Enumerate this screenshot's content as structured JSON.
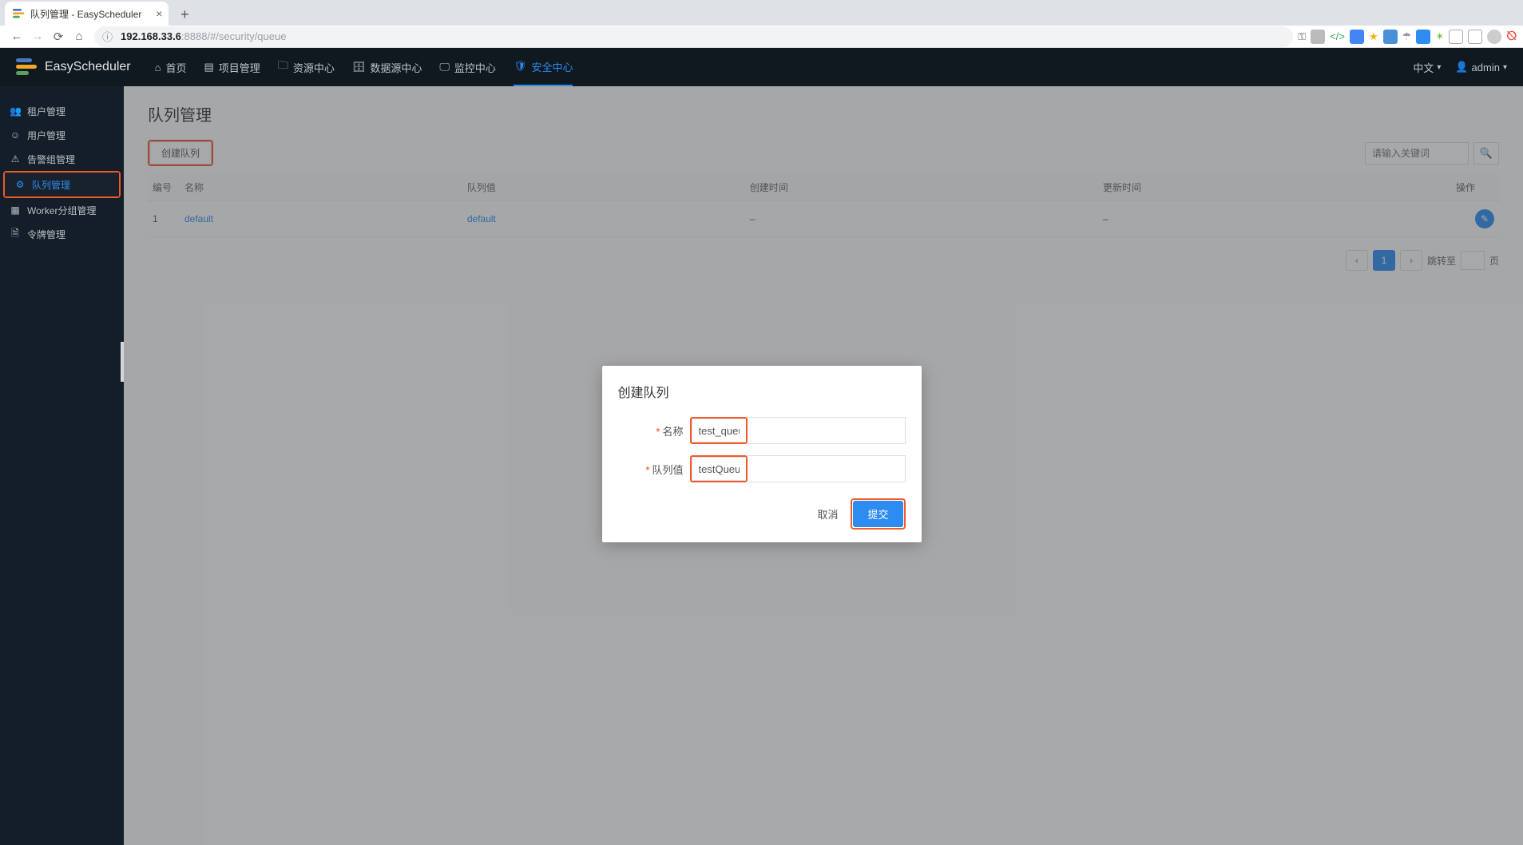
{
  "browser": {
    "tab_title": "队列管理 - EasyScheduler",
    "url_host": "192.168.33.6",
    "url_path": ":8888/#/security/queue"
  },
  "header": {
    "logo": "EasyScheduler",
    "nav": {
      "home": "首页",
      "project": "项目管理",
      "resource": "资源中心",
      "datasource": "数据源中心",
      "monitor": "监控中心",
      "security": "安全中心"
    },
    "lang": "中文",
    "user": "admin"
  },
  "sidebar": {
    "tenant": "租户管理",
    "user": "用户管理",
    "alarm": "告警组管理",
    "queue": "队列管理",
    "worker": "Worker分组管理",
    "token": "令牌管理"
  },
  "page": {
    "title": "队列管理",
    "create_btn": "创建队列",
    "search_placeholder": "请输入关键词",
    "columns": {
      "no": "编号",
      "name": "名称",
      "queue_value": "队列值",
      "create_time": "创建时间",
      "update_time": "更新时间",
      "op": "操作"
    },
    "rows": [
      {
        "no": "1",
        "name": "default",
        "queue": "default",
        "ctime": "–",
        "utime": "–"
      }
    ],
    "pagination": {
      "current": "1",
      "goto_label": "跳转至",
      "page_suffix": "页"
    }
  },
  "modal": {
    "title": "创建队列",
    "label_name": "名称",
    "label_queue": "队列值",
    "value_name": "test_queue",
    "value_queue": "testQueue",
    "cancel": "取消",
    "submit": "提交"
  }
}
